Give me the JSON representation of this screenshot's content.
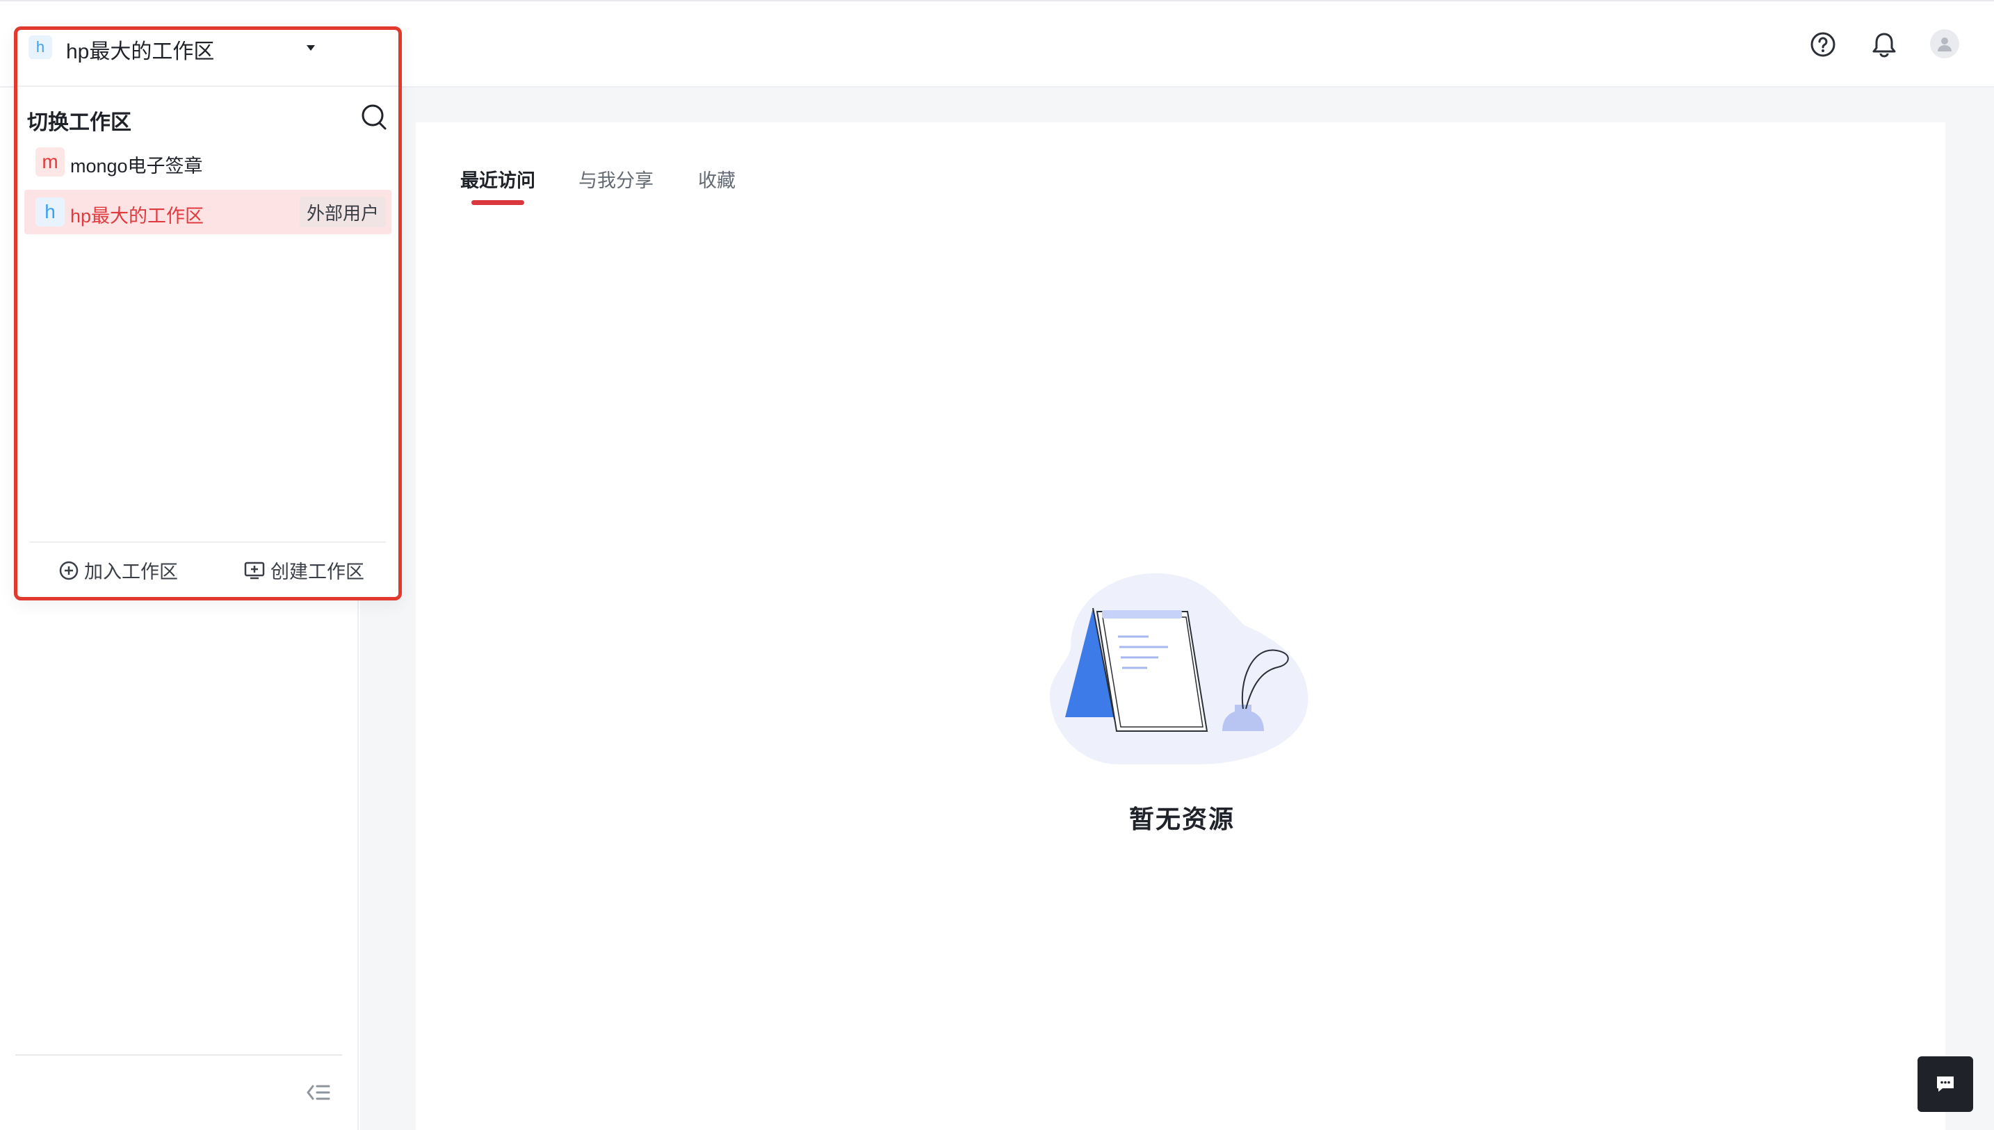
{
  "topbar": {
    "icons": [
      "help-circle-icon",
      "bell-icon",
      "user-avatar-icon"
    ]
  },
  "workspace_switcher": {
    "current_logo": "h",
    "current_name": "hp最大的工作区",
    "switch_title": "切换工作区",
    "items": [
      {
        "logo": "m",
        "name": "mongo电子签章",
        "badge": ""
      },
      {
        "logo": "h",
        "name": "hp最大的工作区",
        "badge": "外部用户"
      }
    ],
    "join_label": "加入工作区",
    "create_label": "创建工作区"
  },
  "tabs": [
    {
      "label": "最近访问",
      "active": true
    },
    {
      "label": "与我分享",
      "active": false
    },
    {
      "label": "收藏",
      "active": false
    }
  ],
  "empty_state": {
    "title": "暂无资源"
  },
  "colors": {
    "accent": "#d9383f",
    "dropdown_border": "#e2392f",
    "active_item_bg": "#fde3e3",
    "illustration_blue": "#3d7be8"
  }
}
